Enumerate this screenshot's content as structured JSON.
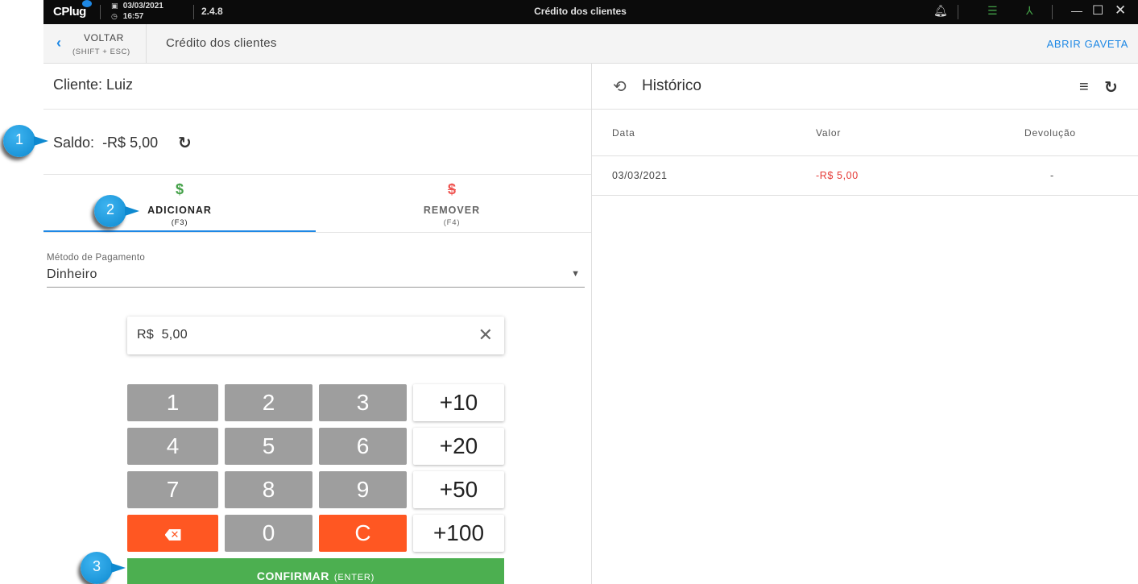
{
  "titlebar": {
    "logo": "CPlug",
    "date": "03/03/2021",
    "time": "16:57",
    "version": "2.4.8",
    "title": "Crédito dos clientes"
  },
  "header": {
    "back_label": "VOLTAR",
    "back_shortcut": "(SHIFT + ESC)",
    "title": "Crédito dos clientes",
    "open_drawer": "ABRIR GAVETA"
  },
  "client": {
    "label": "Cliente: Luiz",
    "balance_label": "Saldo:",
    "balance_value": "-R$ 5,00"
  },
  "tabs": [
    {
      "label": "ADICIONAR",
      "shortcut": "(F3)",
      "active": true
    },
    {
      "label": "REMOVER",
      "shortcut": "(F4)",
      "active": false
    }
  ],
  "payment": {
    "label": "Método de Pagamento",
    "value": "Dinheiro"
  },
  "amount": {
    "currency": "R$",
    "value": "5,00"
  },
  "keypad": {
    "numbers": [
      "1",
      "2",
      "3",
      "4",
      "5",
      "6",
      "7",
      "8",
      "9",
      "0"
    ],
    "increments": [
      "+10",
      "+20",
      "+50",
      "+100"
    ],
    "clear": "C"
  },
  "confirm": {
    "label": "CONFIRMAR",
    "shortcut": "(ENTER)"
  },
  "history": {
    "title": "Histórico",
    "columns": [
      "Data",
      "Valor",
      "Devolução"
    ],
    "rows": [
      {
        "date": "03/03/2021",
        "value": "-R$ 5,00",
        "refund": "-"
      }
    ]
  },
  "markers": [
    "1",
    "2",
    "3"
  ],
  "colors": {
    "accent": "#1e88e5",
    "positive": "#43a047",
    "negative": "#e53935",
    "keypad_red": "#ff5722",
    "confirm": "#4caf50"
  }
}
